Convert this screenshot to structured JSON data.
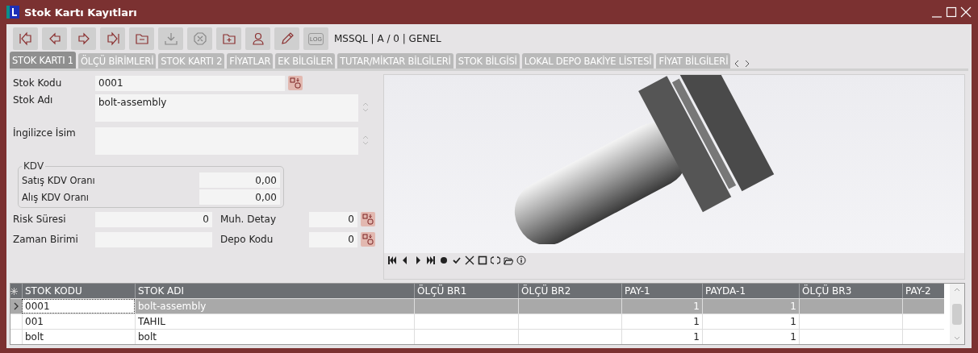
{
  "window": {
    "title": "Stok Kartı Kayıtları"
  },
  "toolbar": {
    "status": "MSSQL | A / 0 | GENEL",
    "log_label": "LOG"
  },
  "tabs": [
    {
      "label": "STOK KARTI 1",
      "selected": true
    },
    {
      "label": "ÖLÇÜ BİRİMLERİ",
      "selected": false
    },
    {
      "label": "STOK KARTI 2",
      "selected": false
    },
    {
      "label": "FİYATLAR",
      "selected": false
    },
    {
      "label": "EK BİLGİLER",
      "selected": false
    },
    {
      "label": "TUTAR/MİKTAR BİLGİLERİ",
      "selected": false
    },
    {
      "label": "STOK BİLGİSİ",
      "selected": false
    },
    {
      "label": "LOKAL DEPO BAKİYE LİSTESİ",
      "selected": false
    },
    {
      "label": "FİYAT BİLGİLERİ",
      "selected": false
    }
  ],
  "form": {
    "stok_kodu": {
      "label": "Stok Kodu",
      "value": "0001"
    },
    "stok_adi": {
      "label": "Stok Adı",
      "value": "bolt-assembly"
    },
    "ingilizce_isim": {
      "label": "İngilizce İsim"
    },
    "kdv": {
      "title": "KDV",
      "satis": {
        "label": "Satış KDV Oranı",
        "value": "0,00"
      },
      "alis": {
        "label": "Alış KDV Oranı",
        "value": "0,00"
      }
    },
    "risk_suresi": {
      "label": "Risk Süresi",
      "value": "0"
    },
    "muh_detay": {
      "label": "Muh. Detay",
      "value": "0"
    },
    "zaman_birimi": {
      "label": "Zaman Birimi"
    },
    "depo_kodu": {
      "label": "Depo Kodu",
      "value": "0"
    }
  },
  "grid": {
    "columns": [
      "STOK KODU",
      "STOK ADI",
      "ÖLÇÜ BR1",
      "ÖLÇÜ BR2",
      "PAY-1",
      "PAYDA-1",
      "ÖLÇÜ BR3",
      "PAY-2"
    ],
    "rows": [
      {
        "cells": [
          "0001",
          "bolt-assembly",
          "",
          "",
          "1",
          "1",
          "",
          ""
        ],
        "selected": true
      },
      {
        "cells": [
          "001",
          "TAHIL",
          "",
          "",
          "1",
          "1",
          "",
          ""
        ],
        "selected": false
      },
      {
        "cells": [
          "bolt",
          "bolt",
          "",
          "",
          "1",
          "1",
          "",
          ""
        ],
        "selected": false
      }
    ]
  }
}
